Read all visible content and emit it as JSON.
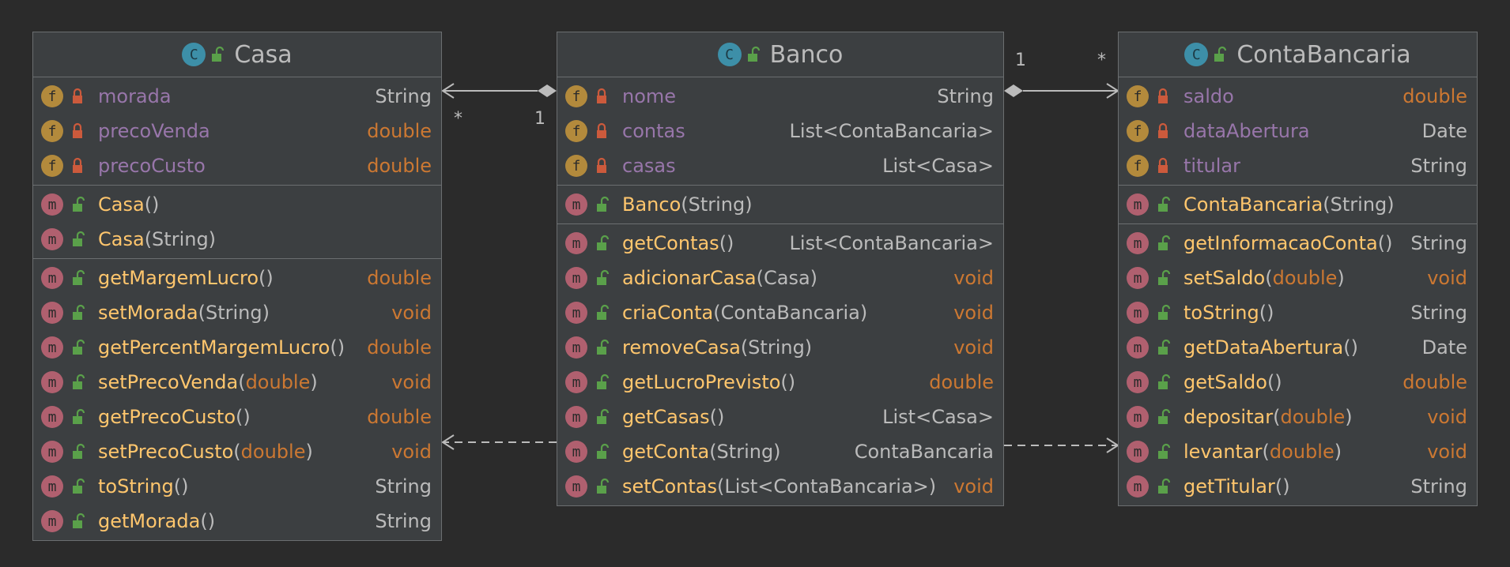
{
  "colors": {
    "background": "#2b2b2b",
    "box": "#3c3f41",
    "border": "#6b6e70",
    "field_name": "#9876aa",
    "method_name": "#ffc66d",
    "keyword": "#cc7832",
    "text": "#bbbbbb"
  },
  "classes": [
    {
      "id": "casa",
      "name": "Casa",
      "icon": "class-icon",
      "fields": [
        {
          "name": "morada",
          "type": "String",
          "type_kw": false
        },
        {
          "name": "precoVenda",
          "type": "double",
          "type_kw": true
        },
        {
          "name": "precoCusto",
          "type": "double",
          "type_kw": true
        }
      ],
      "constructors": [
        {
          "name": "Casa",
          "params": [
            {
              "text": "()",
              "kw": false
            }
          ]
        },
        {
          "name": "Casa",
          "params": [
            {
              "text": "(String)",
              "kw": false
            }
          ]
        }
      ],
      "methods": [
        {
          "name": "getMargemLucro",
          "params": [
            {
              "text": "()",
              "kw": false
            }
          ],
          "type": "double",
          "type_kw": true
        },
        {
          "name": "setMorada",
          "params": [
            {
              "text": "(String)",
              "kw": false
            }
          ],
          "type": "void",
          "type_kw": true
        },
        {
          "name": "getPercentMargemLucro",
          "params": [
            {
              "text": "()",
              "kw": false
            }
          ],
          "type": "double",
          "type_kw": true
        },
        {
          "name": "setPrecoVenda",
          "params": [
            {
              "text": "(",
              "kw": false
            },
            {
              "text": "double",
              "kw": true
            },
            {
              "text": ")",
              "kw": false
            }
          ],
          "type": "void",
          "type_kw": true
        },
        {
          "name": "getPrecoCusto",
          "params": [
            {
              "text": "()",
              "kw": false
            }
          ],
          "type": "double",
          "type_kw": true
        },
        {
          "name": "setPrecoCusto",
          "params": [
            {
              "text": "(",
              "kw": false
            },
            {
              "text": "double",
              "kw": true
            },
            {
              "text": ")",
              "kw": false
            }
          ],
          "type": "void",
          "type_kw": true
        },
        {
          "name": "toString",
          "params": [
            {
              "text": "()",
              "kw": false
            }
          ],
          "type": "String",
          "type_kw": false
        },
        {
          "name": "getMorada",
          "params": [
            {
              "text": "()",
              "kw": false
            }
          ],
          "type": "String",
          "type_kw": false
        }
      ]
    },
    {
      "id": "banco",
      "name": "Banco",
      "icon": "class-icon",
      "fields": [
        {
          "name": "nome",
          "type": "String",
          "type_kw": false
        },
        {
          "name": "contas",
          "type": "List<ContaBancaria>",
          "type_kw": false
        },
        {
          "name": "casas",
          "type": "List<Casa>",
          "type_kw": false
        }
      ],
      "constructors": [
        {
          "name": "Banco",
          "params": [
            {
              "text": "(String)",
              "kw": false
            }
          ]
        }
      ],
      "methods": [
        {
          "name": "getContas",
          "params": [
            {
              "text": "()",
              "kw": false
            }
          ],
          "type": "List<ContaBancaria>",
          "type_kw": false
        },
        {
          "name": "adicionarCasa",
          "params": [
            {
              "text": "(Casa)",
              "kw": false
            }
          ],
          "type": "void",
          "type_kw": true
        },
        {
          "name": "criaConta",
          "params": [
            {
              "text": "(ContaBancaria)",
              "kw": false
            }
          ],
          "type": "void",
          "type_kw": true
        },
        {
          "name": "removeCasa",
          "params": [
            {
              "text": "(String)",
              "kw": false
            }
          ],
          "type": "void",
          "type_kw": true
        },
        {
          "name": "getLucroPrevisto",
          "params": [
            {
              "text": "()",
              "kw": false
            }
          ],
          "type": "double",
          "type_kw": true
        },
        {
          "name": "getCasas",
          "params": [
            {
              "text": "()",
              "kw": false
            }
          ],
          "type": "List<Casa>",
          "type_kw": false
        },
        {
          "name": "getConta",
          "params": [
            {
              "text": "(String)",
              "kw": false
            }
          ],
          "type": "ContaBancaria",
          "type_kw": false
        },
        {
          "name": "setContas",
          "params": [
            {
              "text": "(List<ContaBancaria>)",
              "kw": false
            }
          ],
          "type": "void",
          "type_kw": true
        }
      ]
    },
    {
      "id": "contabancaria",
      "name": "ContaBancaria",
      "icon": "class-icon",
      "fields": [
        {
          "name": "saldo",
          "type": "double",
          "type_kw": true
        },
        {
          "name": "dataAbertura",
          "type": "Date",
          "type_kw": false
        },
        {
          "name": "titular",
          "type": "String",
          "type_kw": false
        }
      ],
      "constructors": [
        {
          "name": "ContaBancaria",
          "params": [
            {
              "text": "(String)",
              "kw": false
            }
          ]
        }
      ],
      "methods": [
        {
          "name": "getInformacaoConta",
          "params": [
            {
              "text": "()",
              "kw": false
            }
          ],
          "type": "String",
          "type_kw": false
        },
        {
          "name": "setSaldo",
          "params": [
            {
              "text": "(",
              "kw": false
            },
            {
              "text": "double",
              "kw": true
            },
            {
              "text": ")",
              "kw": false
            }
          ],
          "type": "void",
          "type_kw": true
        },
        {
          "name": "toString",
          "params": [
            {
              "text": "()",
              "kw": false
            }
          ],
          "type": "String",
          "type_kw": false
        },
        {
          "name": "getDataAbertura",
          "params": [
            {
              "text": "()",
              "kw": false
            }
          ],
          "type": "Date",
          "type_kw": false
        },
        {
          "name": "getSaldo",
          "params": [
            {
              "text": "()",
              "kw": false
            }
          ],
          "type": "double",
          "type_kw": true
        },
        {
          "name": "depositar",
          "params": [
            {
              "text": "(",
              "kw": false
            },
            {
              "text": "double",
              "kw": true
            },
            {
              "text": ")",
              "kw": false
            }
          ],
          "type": "void",
          "type_kw": true
        },
        {
          "name": "levantar",
          "params": [
            {
              "text": "(",
              "kw": false
            },
            {
              "text": "double",
              "kw": true
            },
            {
              "text": ")",
              "kw": false
            }
          ],
          "type": "void",
          "type_kw": true
        },
        {
          "name": "getTitular",
          "params": [
            {
              "text": "()",
              "kw": false
            }
          ],
          "type": "String",
          "type_kw": false
        }
      ]
    }
  ],
  "relations": [
    {
      "kind": "composition",
      "from": "banco",
      "to": "casa",
      "from_mult": "1",
      "to_mult": "*"
    },
    {
      "kind": "composition",
      "from": "banco",
      "to": "contabancaria",
      "from_mult": "1",
      "to_mult": "*"
    },
    {
      "kind": "dependency",
      "from": "banco",
      "to": "casa"
    },
    {
      "kind": "dependency",
      "from": "banco",
      "to": "contabancaria"
    }
  ],
  "icons": {
    "field": "f",
    "method": "m",
    "class": "C"
  }
}
